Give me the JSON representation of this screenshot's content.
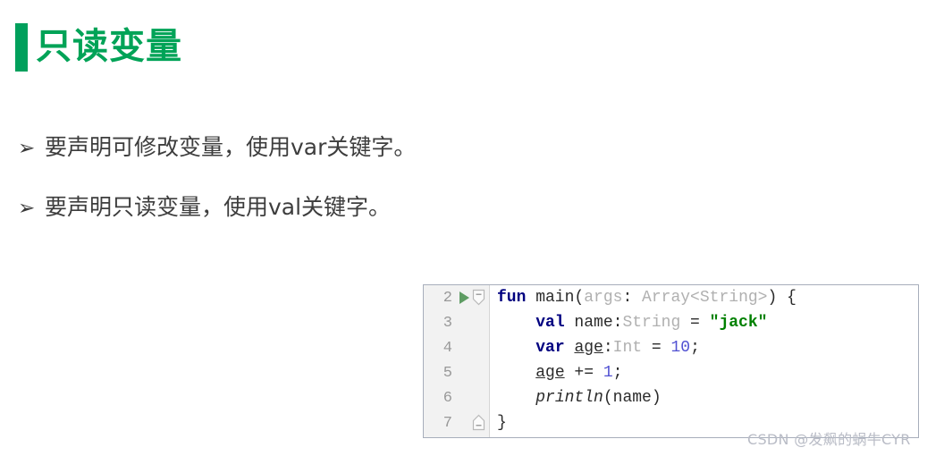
{
  "slide": {
    "title": "只读变量",
    "accent_color": "#00a05c",
    "title_color": "#00a357",
    "background_color": "#ffffff"
  },
  "bullets": {
    "marker": "➢",
    "items": [
      {
        "text": "要声明可修改变量，使用var关键字。"
      },
      {
        "text": "要声明只读变量，使用val关键字。"
      }
    ]
  },
  "code_block": {
    "gutter": {
      "background_color": "#f2f2f2",
      "line_numbers": [
        "2",
        "3",
        "4",
        "5",
        "6",
        "7"
      ],
      "run_icon": "run-triangle-icon",
      "fold_open_icon": "fold-open-icon",
      "fold_close_icon": "fold-close-icon"
    },
    "colors": {
      "keyword": "#000080",
      "string": "#008000",
      "number": "#5050d2",
      "type": "#b0b0b0",
      "plain": "#2b2b2b",
      "border": "#a7aebb"
    },
    "lines": [
      {
        "number": "2",
        "tokens": [
          {
            "t": "fun",
            "c": "kw"
          },
          {
            "t": " main(",
            "c": "plain"
          },
          {
            "t": "args",
            "c": "param"
          },
          {
            "t": ": ",
            "c": "plain"
          },
          {
            "t": "Array<String>",
            "c": "type"
          },
          {
            "t": ") {",
            "c": "plain"
          }
        ]
      },
      {
        "number": "3",
        "tokens": [
          {
            "t": "    ",
            "c": "plain"
          },
          {
            "t": "val",
            "c": "kw"
          },
          {
            "t": " name:",
            "c": "plain"
          },
          {
            "t": "String",
            "c": "type"
          },
          {
            "t": " = ",
            "c": "plain"
          },
          {
            "t": "\"jack\"",
            "c": "str"
          }
        ]
      },
      {
        "number": "4",
        "tokens": [
          {
            "t": "    ",
            "c": "plain"
          },
          {
            "t": "var",
            "c": "kw"
          },
          {
            "t": " ",
            "c": "plain"
          },
          {
            "t": "age",
            "c": "var"
          },
          {
            "t": ":",
            "c": "plain"
          },
          {
            "t": "Int",
            "c": "type"
          },
          {
            "t": " = ",
            "c": "plain"
          },
          {
            "t": "10",
            "c": "num"
          },
          {
            "t": ";",
            "c": "plain"
          }
        ]
      },
      {
        "number": "5",
        "tokens": [
          {
            "t": "    ",
            "c": "plain"
          },
          {
            "t": "age",
            "c": "var"
          },
          {
            "t": " += ",
            "c": "plain"
          },
          {
            "t": "1",
            "c": "num"
          },
          {
            "t": ";",
            "c": "plain"
          }
        ]
      },
      {
        "number": "6",
        "tokens": [
          {
            "t": "    ",
            "c": "plain"
          },
          {
            "t": "println",
            "c": "fn"
          },
          {
            "t": "(name)",
            "c": "plain"
          }
        ]
      },
      {
        "number": "7",
        "tokens": [
          {
            "t": "}",
            "c": "plain"
          }
        ]
      }
    ]
  },
  "watermark": {
    "text": "CSDN @发飙的蜗牛CYR"
  }
}
